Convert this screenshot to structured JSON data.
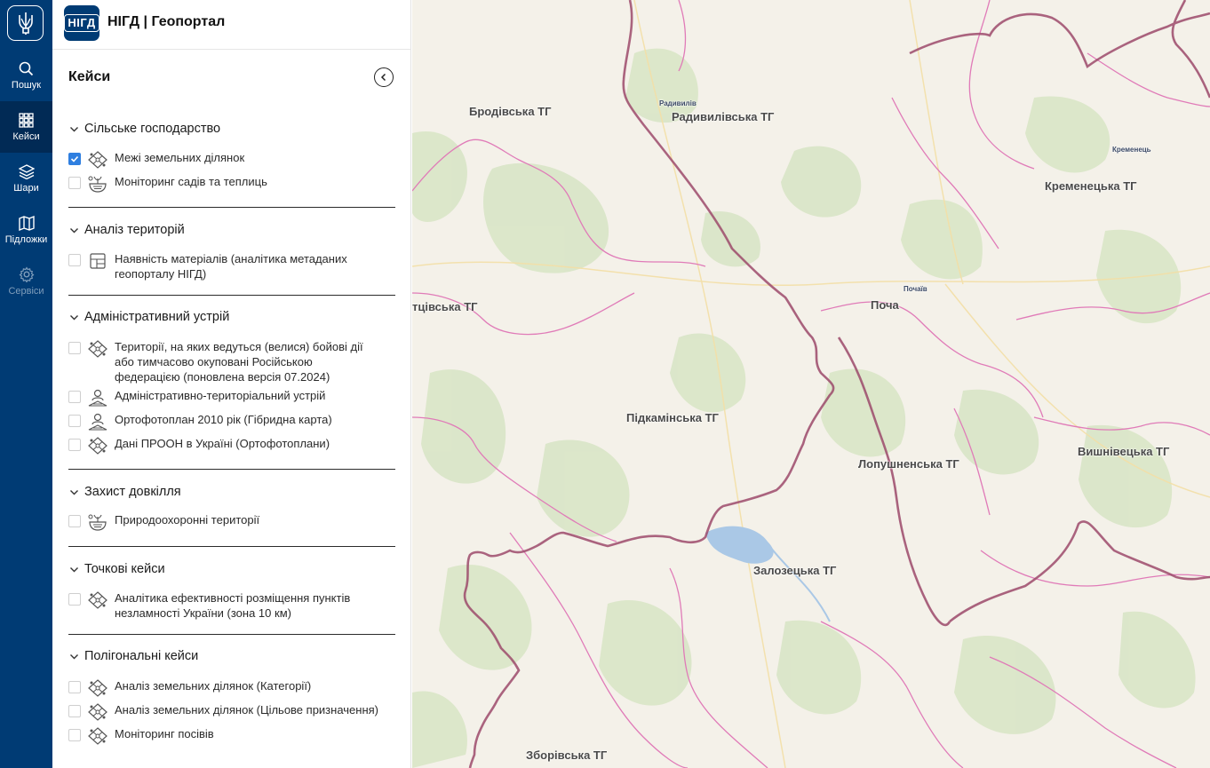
{
  "app": {
    "brand_logo_text": "НІГД",
    "brand_title": "НІГД | Геопортал"
  },
  "rail": {
    "items": [
      {
        "label": "Пошук",
        "icon": "search-icon"
      },
      {
        "label": "Кейси",
        "icon": "grid-icon"
      },
      {
        "label": "Шари",
        "icon": "layers-icon"
      },
      {
        "label": "Підложки",
        "icon": "map-icon"
      },
      {
        "label": "Сервіси",
        "icon": "gear-icon"
      }
    ],
    "active": "Кейси"
  },
  "panel": {
    "title": "Кейси",
    "sections": [
      {
        "title": "Сільське господарство",
        "items": [
          {
            "label": "Межі земельних ділянок",
            "checked": true,
            "icon": "parcel-icon"
          },
          {
            "label": "Моніторинг садів та теплиць",
            "checked": false,
            "icon": "greenhouse-icon"
          }
        ]
      },
      {
        "title": "Аналіз територій",
        "items": [
          {
            "label": "Наявність матеріалів (аналітика метаданих геопорталу НІГД)",
            "checked": false,
            "icon": "layout-icon"
          }
        ]
      },
      {
        "title": "Адміністративний устрій",
        "items": [
          {
            "label": "Території, на яких ведуться (велися) бойові дії або тимчасово окуповані Російською федерацією (поновлена версія 07.2024)",
            "checked": false,
            "icon": "parcel-icon"
          },
          {
            "label": "Адміністративно-територіальний устрій",
            "checked": false,
            "icon": "person-pin-icon"
          },
          {
            "label": "Ортофотоплан 2010 рік (Гібридна карта)",
            "checked": false,
            "icon": "person-pin-icon"
          },
          {
            "label": "Дані ПРООН в Україні (Ортофотоплани)",
            "checked": false,
            "icon": "parcel-icon"
          }
        ]
      },
      {
        "title": "Захист довкілля",
        "items": [
          {
            "label": "Природоохоронні території",
            "checked": false,
            "icon": "greenhouse-icon"
          }
        ]
      },
      {
        "title": "Точкові кейси",
        "items": [
          {
            "label": "Аналітика ефективності розміщення пунктів незламності України (зона 10 км)",
            "checked": false,
            "icon": "parcel-icon"
          }
        ]
      },
      {
        "title": "Полігональні кейси",
        "items": [
          {
            "label": "Аналіз земельних ділянок (Категорії)",
            "checked": false,
            "icon": "parcel-icon"
          },
          {
            "label": "Аналіз земельних ділянок (Цільове призначення)",
            "checked": false,
            "icon": "parcel-icon"
          },
          {
            "label": "Моніторинг посівів",
            "checked": false,
            "icon": "parcel-icon"
          }
        ]
      }
    ]
  },
  "map": {
    "labels": [
      "Бродівська ТГ",
      "Радивилівська ТГ",
      "Радивилів",
      "Кременецька ТГ",
      "Кременець",
      "тцівська ТГ",
      "Поча",
      "Почаїв",
      "Підкамінська ТГ",
      "Лопушненська ТГ",
      "Вишнівецька ТГ",
      "Залозецька ТГ",
      "Зборівська ТГ"
    ],
    "colors": {
      "background": "#f4f1e9",
      "forest": "#d6e3c4",
      "boundary_major": "#9c4a6b",
      "boundary_minor": "#e07bb8",
      "water": "#aac8e6"
    }
  }
}
